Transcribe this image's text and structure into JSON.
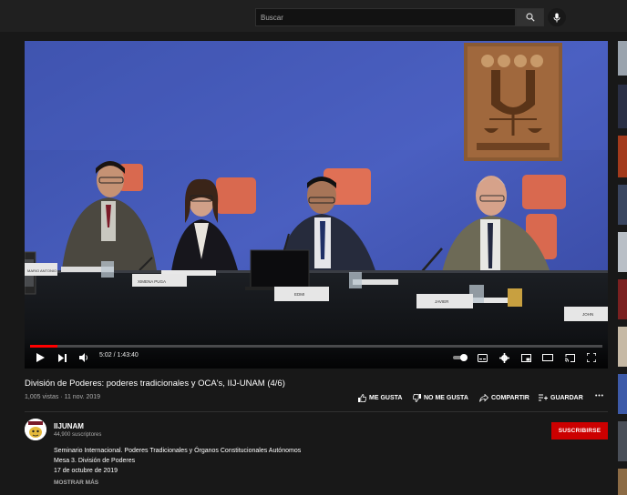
{
  "search": {
    "placeholder": "Buscar"
  },
  "icons": {
    "search": "search-icon",
    "mic": "microphone-icon",
    "play": "play-icon",
    "next": "next-icon",
    "volume": "volume-icon",
    "autoplay": "autoplay-toggle-icon",
    "captions": "captions-icon",
    "settings": "gear-icon",
    "miniplayer": "miniplayer-icon",
    "theater": "theater-mode-icon",
    "cast": "cast-icon",
    "fullscreen": "fullscreen-icon",
    "like": "thumbs-up-icon",
    "dislike": "thumbs-down-icon",
    "share": "share-icon",
    "save": "playlist-add-icon",
    "more": "more-icon"
  },
  "player": {
    "time": "5:02 / 1:43:40",
    "progress": 0.048,
    "scene": {
      "nameplates": [
        "MARIO ANTONIO",
        "XIMENA PUGA",
        "EDMI",
        "JAVIER",
        "JOHN"
      ]
    }
  },
  "video": {
    "title": "División de Poderes: poderes tradicionales y OCA's, IIJ-UNAM (4/6)",
    "meta": "1,005 vistas · 11 nov. 2019",
    "actions": {
      "like": "ME GUSTA",
      "dislike": "NO ME GUSTA",
      "share": "COMPARTIR",
      "save": "GUARDAR"
    }
  },
  "channel": {
    "name": "IIJUNAM",
    "subscribers": "44,900 suscriptores",
    "subscribe_label": "SUSCRIBIRSE"
  },
  "description": {
    "lines": [
      "Seminario Internacional. Poderes Tradicionales y Órganos Constitucionales Autónomos",
      "Mesa 3. División de Poderes",
      "17 de octubre de 2019"
    ],
    "show_more": "MOSTRAR MÁS"
  },
  "colors": {
    "accent": "#cc0000",
    "progress": "#ff0000",
    "background": "#181818"
  }
}
